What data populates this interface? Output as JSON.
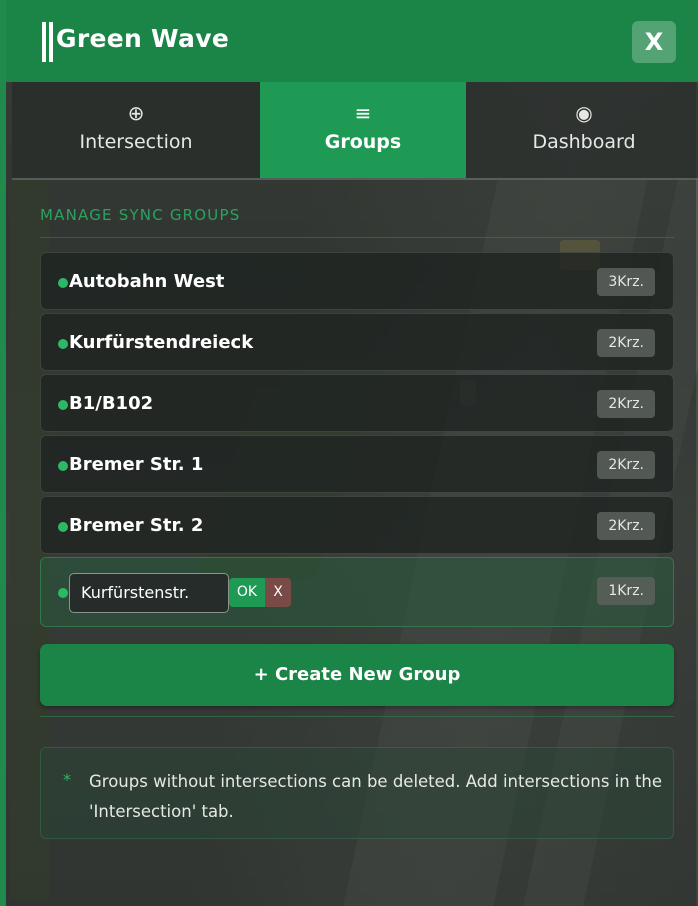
{
  "window": {
    "title": "Green Wave",
    "close_label": "X"
  },
  "tabs": [
    {
      "icon": "⊕",
      "icon_name": "crosshair-plus-icon",
      "label": "Intersection"
    },
    {
      "icon": "≡",
      "icon_name": "menu-lines-icon",
      "label": "Groups"
    },
    {
      "icon": "◉",
      "icon_name": "radio-dot-icon",
      "label": "Dashboard"
    }
  ],
  "active_tab": "Groups",
  "section_title": "MANAGE SYNC GROUPS",
  "groups": [
    {
      "name": "Autobahn West",
      "count": "3Krz."
    },
    {
      "name": "Kurfürstendreieck",
      "count": "2Krz."
    },
    {
      "name": "B1/B102",
      "count": "2Krz."
    },
    {
      "name": "Bremer Str. 1",
      "count": "2Krz."
    },
    {
      "name": "Bremer Str. 2",
      "count": "2Krz."
    }
  ],
  "editing_group": {
    "value": "Kurfürstenstr.",
    "ok_label": "OK",
    "cancel_label": "X",
    "count": "1Krz."
  },
  "create_label": "+ Create New Group",
  "note": {
    "bullet": "*",
    "text": "Groups without intersections can be deleted. Add intersections in the 'Intersection' tab."
  },
  "colors": {
    "accent": "#1b8447",
    "active_tab": "#1f9a55",
    "dot": "#2db866",
    "section_title": "#2aa35f"
  }
}
